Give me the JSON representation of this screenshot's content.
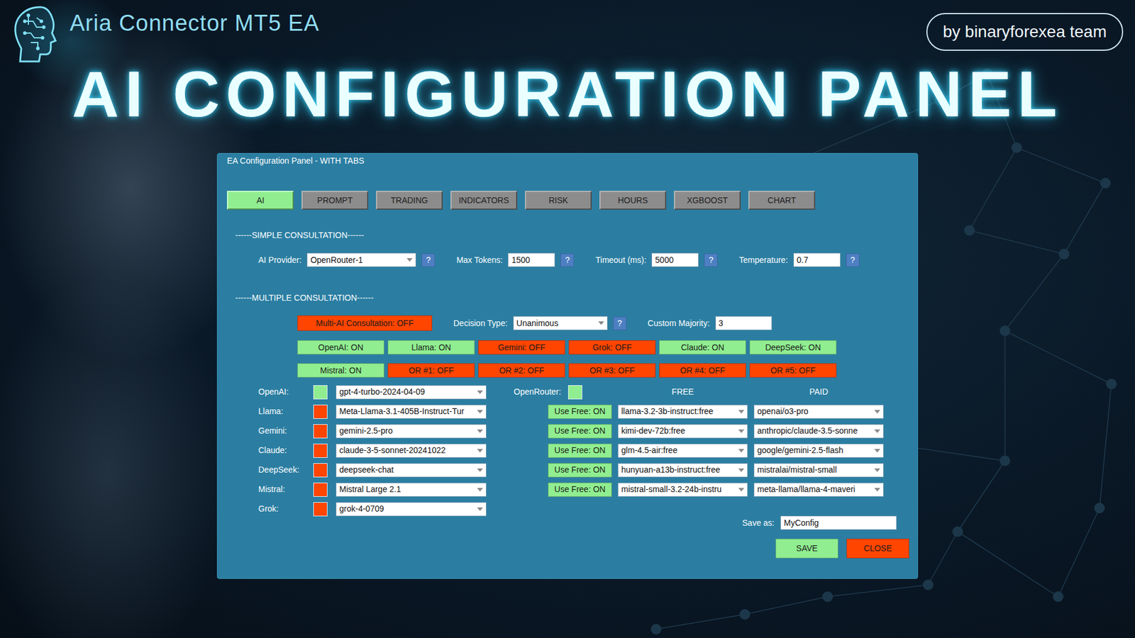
{
  "brand": {
    "name": "Aria Connector MT5 EA",
    "credit": "by binaryforexea team"
  },
  "headline": "AI CONFIGURATION PANEL",
  "window": {
    "title": "EA Configuration Panel - WITH TABS"
  },
  "tabs": [
    {
      "label": "AI",
      "selected": true
    },
    {
      "label": "PROMPT",
      "selected": false
    },
    {
      "label": "TRADING",
      "selected": false
    },
    {
      "label": "INDICATORS",
      "selected": false
    },
    {
      "label": "RISK",
      "selected": false
    },
    {
      "label": "HOURS",
      "selected": false
    },
    {
      "label": "XGBOOST",
      "selected": false
    },
    {
      "label": "CHART",
      "selected": false
    }
  ],
  "simple": {
    "heading": "------SIMPLE CONSULTATION------",
    "fields": [
      {
        "label": "AI Provider:",
        "value": "OpenRouter-1",
        "kind": "dropdown",
        "help": "?"
      },
      {
        "label": "Max Tokens:",
        "value": "1500",
        "kind": "input",
        "help": "?"
      },
      {
        "label": "Timeout (ms):",
        "value": "5000",
        "kind": "input",
        "help": "?"
      },
      {
        "label": "Temperature:",
        "value": "0.7",
        "kind": "input",
        "help": "?"
      }
    ]
  },
  "multiple": {
    "heading": "------MULTIPLE CONSULTATION------",
    "toggle": {
      "label": "Multi-AI Consultation: OFF",
      "on": false
    },
    "fields": [
      {
        "label": "Decision Type:",
        "value": "Unanimous",
        "kind": "dropdown",
        "help": "?"
      },
      {
        "label": "Custom Majority:",
        "value": "3",
        "kind": "input"
      }
    ],
    "providers": [
      {
        "label": "OpenAI: ON",
        "on": true
      },
      {
        "label": "Llama: ON",
        "on": true
      },
      {
        "label": "Gemini: OFF",
        "on": false
      },
      {
        "label": "Grok: OFF",
        "on": false
      },
      {
        "label": "Claude: ON",
        "on": true
      },
      {
        "label": "DeepSeek: ON",
        "on": true
      },
      {
        "label": "Mistral: ON",
        "on": true
      },
      {
        "label": "OR #1: OFF",
        "on": false
      },
      {
        "label": "OR #2: OFF",
        "on": false
      },
      {
        "label": "OR #3: OFF",
        "on": false
      },
      {
        "label": "OR #4: OFF",
        "on": false
      },
      {
        "label": "OR #5: OFF",
        "on": false
      }
    ]
  },
  "models": [
    {
      "label": "OpenAI:",
      "enabled": true,
      "value": "gpt-4-turbo-2024-04-09"
    },
    {
      "label": "Llama:",
      "enabled": false,
      "value": "Meta-Llama-3.1-405B-Instruct-Tur"
    },
    {
      "label": "Gemini:",
      "enabled": false,
      "value": "gemini-2.5-pro"
    },
    {
      "label": "Claude:",
      "enabled": false,
      "value": "claude-3-5-sonnet-20241022"
    },
    {
      "label": "DeepSeek:",
      "enabled": false,
      "value": "deepseek-chat"
    },
    {
      "label": "Mistral:",
      "enabled": false,
      "value": "Mistral Large 2.1"
    },
    {
      "label": "Grok:",
      "enabled": false,
      "value": "grok-4-0709"
    }
  ],
  "openrouter": {
    "label": "OpenRouter:",
    "enabled": true,
    "free_header": "FREE",
    "paid_header": "PAID",
    "rows": [
      {
        "toggle": "Use Free: ON",
        "on": true,
        "free": "llama-3.2-3b-instruct:free",
        "paid": "openai/o3-pro"
      },
      {
        "toggle": "Use Free: ON",
        "on": true,
        "free": "kimi-dev-72b:free",
        "paid": "anthropic/claude-3.5-sonne"
      },
      {
        "toggle": "Use Free: ON",
        "on": true,
        "free": "glm-4.5-air:free",
        "paid": "google/gemini-2.5-flash"
      },
      {
        "toggle": "Use Free: ON",
        "on": true,
        "free": "hunyuan-a13b-instruct:free",
        "paid": "mistralai/mistral-small"
      },
      {
        "toggle": "Use Free: ON",
        "on": true,
        "free": "mistral-small-3.2-24b-instru",
        "paid": "meta-llama/llama-4-maveri"
      }
    ]
  },
  "save": {
    "label": "Save as:",
    "value": "MyConfig"
  },
  "buttons": [
    {
      "label": "SAVE",
      "kind": "save"
    },
    {
      "label": "CLOSE",
      "kind": "close"
    }
  ]
}
